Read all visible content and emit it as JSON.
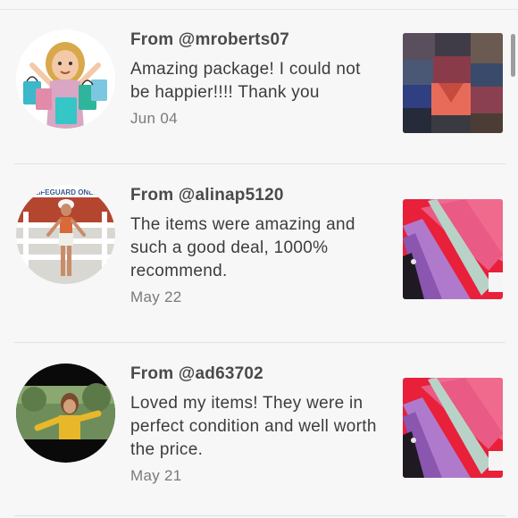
{
  "reviews": [
    {
      "from": "From @mroberts07",
      "message": "Amazing package! I could not be happier!!!! Thank you",
      "date": "Jun 04",
      "avatar_icon": "bitmoji-shopping-bags-avatar",
      "thumb_icon": "folded-clothes-photo"
    },
    {
      "from": "From @alinap5120",
      "message": "The items were amazing and such a good deal, 1000% recommend.",
      "date": "May 22",
      "avatar_icon": "lifeguard-stand-photo-avatar",
      "avatar_sign_text": "LIFEGUARD ONLY",
      "thumb_icon": "pink-leggings-photo"
    },
    {
      "from": "From @ad63702",
      "message": "Loved my items! They were in perfect condition and well worth the price.",
      "date": "May 21",
      "avatar_icon": "yellow-top-photo-avatar",
      "thumb_icon": "pink-leggings-photo"
    }
  ],
  "colors": {
    "background": "#f7f7f7",
    "primary_text": "#3c3c3c",
    "secondary_text": "#7a7a7a",
    "divider": "#e2e2e2"
  }
}
